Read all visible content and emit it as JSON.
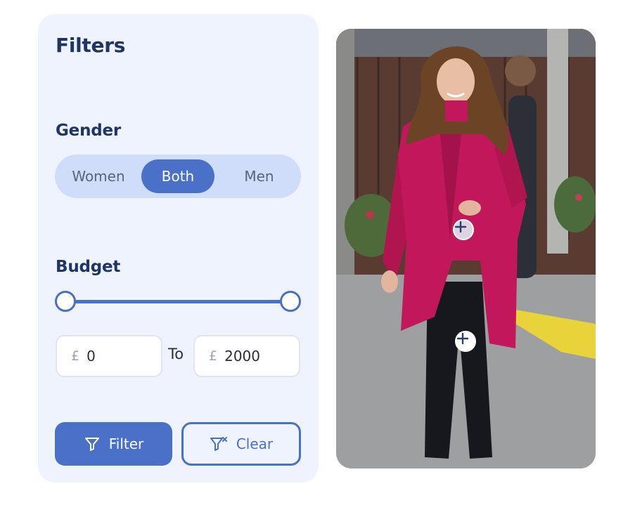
{
  "filters": {
    "title": "Filters",
    "gender": {
      "label": "Gender",
      "options": [
        "Women",
        "Both",
        "Men"
      ],
      "selected": "Both"
    },
    "budget": {
      "label": "Budget",
      "currency_symbol": "£",
      "min_value": "0",
      "max_value": "2000",
      "separator": "To",
      "slider_min_fraction": 0,
      "slider_max_fraction": 1
    },
    "actions": {
      "filter_label": "Filter",
      "clear_label": "Clear"
    }
  },
  "photo": {
    "hotspot_count": 2,
    "icons": [
      "plus-icon",
      "plus-icon"
    ]
  },
  "colors": {
    "accent": "#4a70c8",
    "panel_bg": "#eef3fe",
    "heading": "#1e3566",
    "segment_bg": "#cfdcfa",
    "coat": "#c2185b"
  }
}
